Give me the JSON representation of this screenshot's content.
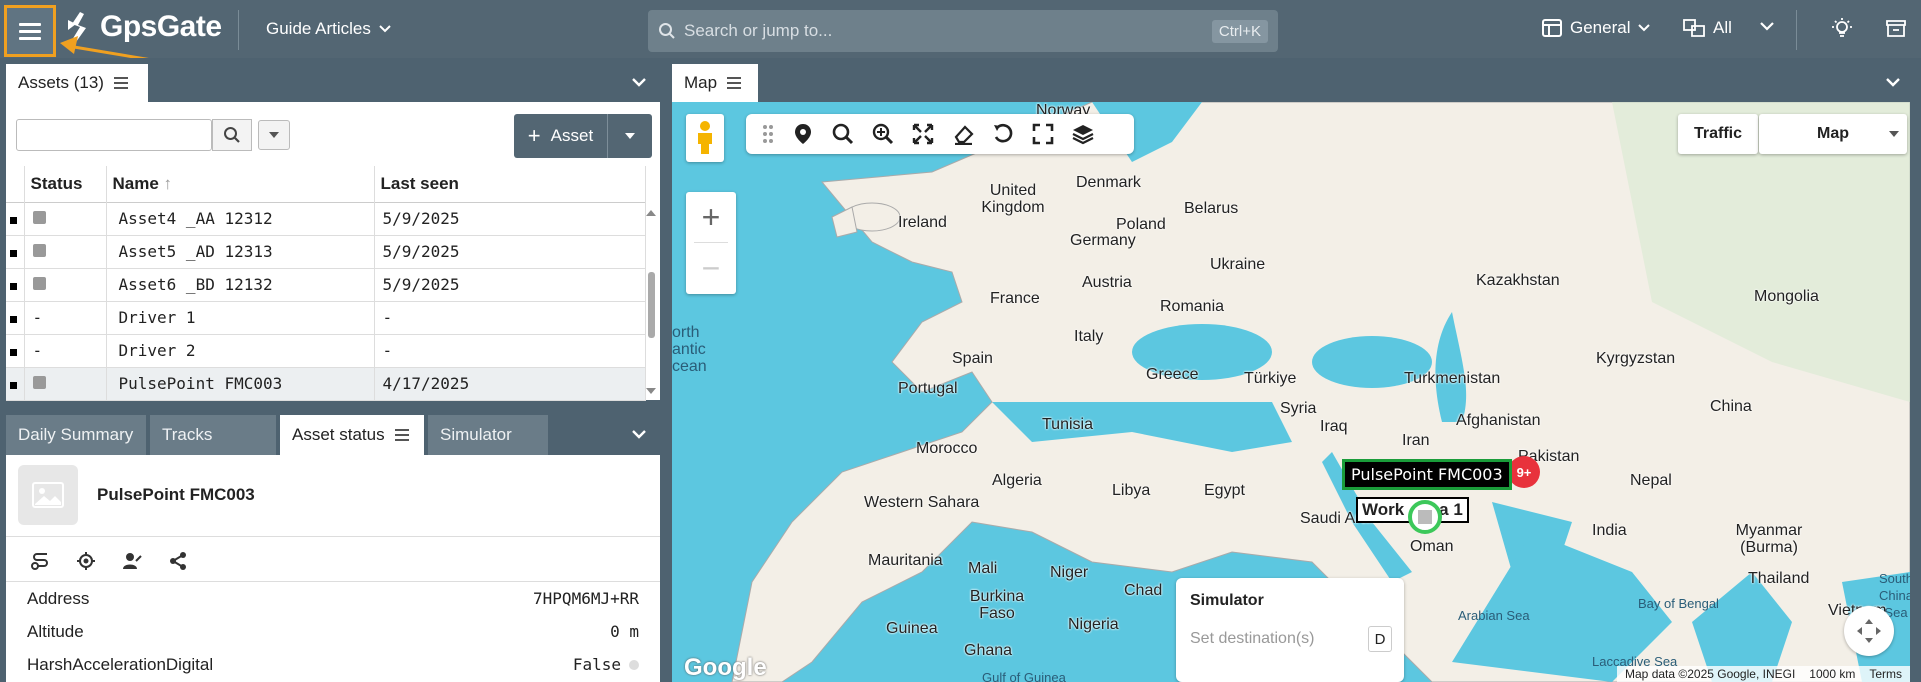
{
  "header": {
    "brand": "GpsGate",
    "guide_label": "Guide Articles",
    "search_placeholder": "Search or jump to...",
    "search_shortcut": "Ctrl+K",
    "view_label": "General",
    "filter_label": "All"
  },
  "assets_panel": {
    "tab_label": "Assets (13)",
    "add_button": "Asset",
    "columns": [
      "Status",
      "Name",
      "Last seen"
    ],
    "rows": [
      {
        "status": "sq",
        "name": "Asset4 _AA 12312",
        "last_seen": "5/9/2025"
      },
      {
        "status": "sq",
        "name": "Asset5 _AD 12313",
        "last_seen": "5/9/2025"
      },
      {
        "status": "sq",
        "name": "Asset6 _BD 12132",
        "last_seen": "5/9/2025"
      },
      {
        "status": "-",
        "name": "Driver 1",
        "last_seen": "-"
      },
      {
        "status": "-",
        "name": "Driver 2",
        "last_seen": "-"
      },
      {
        "status": "sq",
        "name": "PulsePoint FMC003",
        "last_seen": "4/17/2025"
      }
    ]
  },
  "bottom_panel": {
    "tabs": [
      "Daily Summary",
      "Tracks",
      "Asset status",
      "Simulator"
    ],
    "active_tab": "Asset status",
    "asset_name": "PulsePoint FMC003",
    "properties": [
      {
        "label": "Address",
        "value": "7HPQM6MJ+RR"
      },
      {
        "label": "Altitude",
        "value": "0 m"
      },
      {
        "label": "HarshAccelerationDigital",
        "value": "False"
      }
    ]
  },
  "map_panel": {
    "tab_label": "Map",
    "traffic_button": "Traffic",
    "map_type": "Map",
    "asset_label": "PulsePoint FMC003",
    "area_label": "Work  area 1",
    "cluster_count": "9+",
    "simulator": {
      "title": "Simulator",
      "placeholder": "Set destination(s)",
      "key": "D"
    },
    "footer": {
      "google": "Google",
      "attribution": "Map data ©2025 Google, INEGI",
      "scale": "1000 km",
      "terms": "Terms"
    },
    "ocean_text": [
      "orth",
      "antic",
      "cean"
    ],
    "countries": [
      "Denmark",
      "United Kingdom",
      "Ireland",
      "Poland",
      "Belarus",
      "Germany",
      "Ukraine",
      "France",
      "Austria",
      "Romania",
      "Kazakhstan",
      "Mongolia",
      "Italy",
      "Spain",
      "Portugal",
      "Greece",
      "Türkiye",
      "Turkmenistan",
      "Kyrgyzstan",
      "Tunisia",
      "Syria",
      "Iraq",
      "Iran",
      "Afghanistan",
      "Pakistan",
      "China",
      "Morocco",
      "Algeria",
      "Libya",
      "Egypt",
      "Saudi Arabia",
      "Nepal",
      "Western Sahara",
      "India",
      "Oman",
      "Mauritania",
      "Mali",
      "Niger",
      "Chad",
      "Myanmar (Burma)",
      "Thailand",
      "Burkina Faso",
      "Nigeria",
      "Guinea",
      "Ghana",
      "Arabian Sea",
      "Bay of Bengal",
      "Vietnam",
      "Laccadive Sea",
      "South China Sea",
      "Gulf of Guinea",
      "Norway"
    ]
  },
  "colors": {
    "topbar": "#536673",
    "accent": "#f0a020",
    "highlight_green": "#1a9c3a",
    "cluster_red": "#e8323c"
  }
}
